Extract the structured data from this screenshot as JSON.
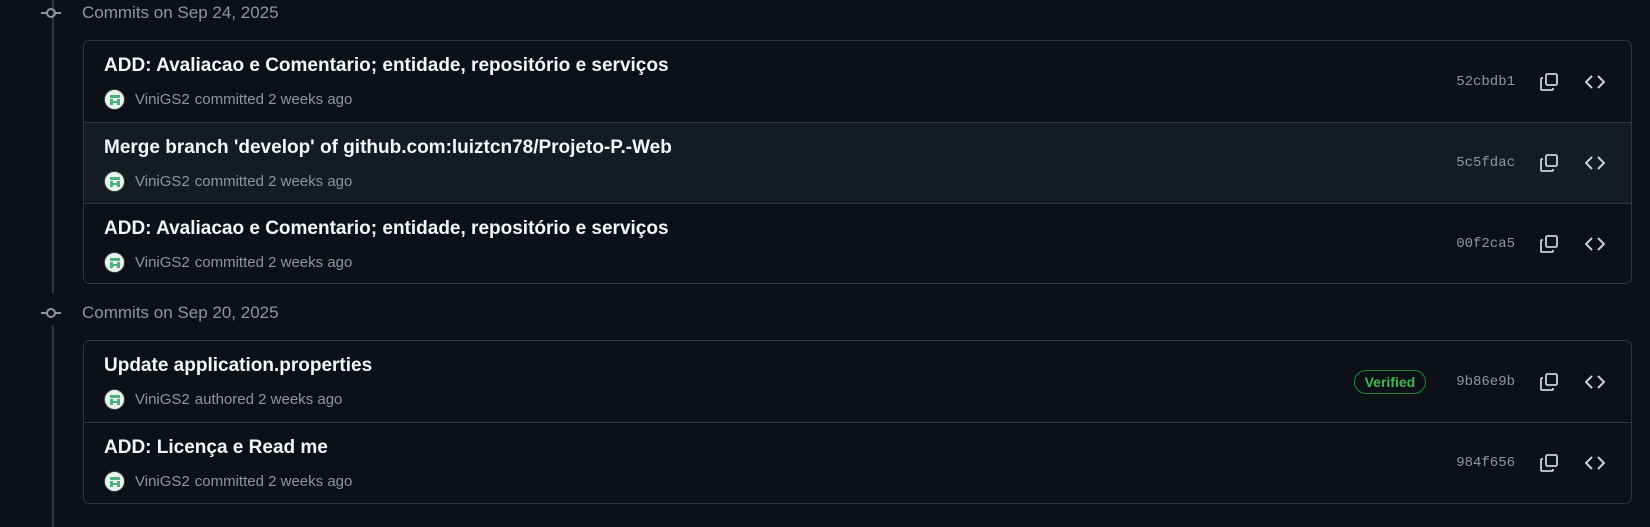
{
  "groups": [
    {
      "title": "Commits on Sep 24, 2025",
      "commits": [
        {
          "message": "ADD: Avaliacao e Comentario; entidade, repositório e serviços",
          "author": "ViniGS2",
          "action": "committed",
          "time": "2 weeks ago",
          "sha": "52cbdb1",
          "verified": false
        },
        {
          "message": "Merge branch 'develop' of github.com:luiztcn78/Projeto-P.-Web",
          "author": "ViniGS2",
          "action": "committed",
          "time": "2 weeks ago",
          "sha": "5c5fdac",
          "verified": false
        },
        {
          "message": "ADD: Avaliacao e Comentario; entidade, repositório e serviços",
          "author": "ViniGS2",
          "action": "committed",
          "time": "2 weeks ago",
          "sha": "00f2ca5",
          "verified": false
        }
      ]
    },
    {
      "title": "Commits on Sep 20, 2025",
      "commits": [
        {
          "message": "Update application.properties",
          "author": "ViniGS2",
          "action": "authored",
          "time": "2 weeks ago",
          "sha": "9b86e9b",
          "verified": true,
          "badge": "Verified"
        },
        {
          "message": "ADD: Licença e Read me",
          "author": "ViniGS2",
          "action": "committed",
          "time": "2 weeks ago",
          "sha": "984f656",
          "verified": false
        }
      ]
    }
  ],
  "icons": {
    "group": "git-commit-icon",
    "copy": "copy-icon",
    "browse": "code-icon",
    "avatar": "avatar-identicon"
  },
  "colors": {
    "background": "#0d1117",
    "border": "#30363d",
    "muted": "#8d96a0",
    "verified": "#3fb950"
  }
}
